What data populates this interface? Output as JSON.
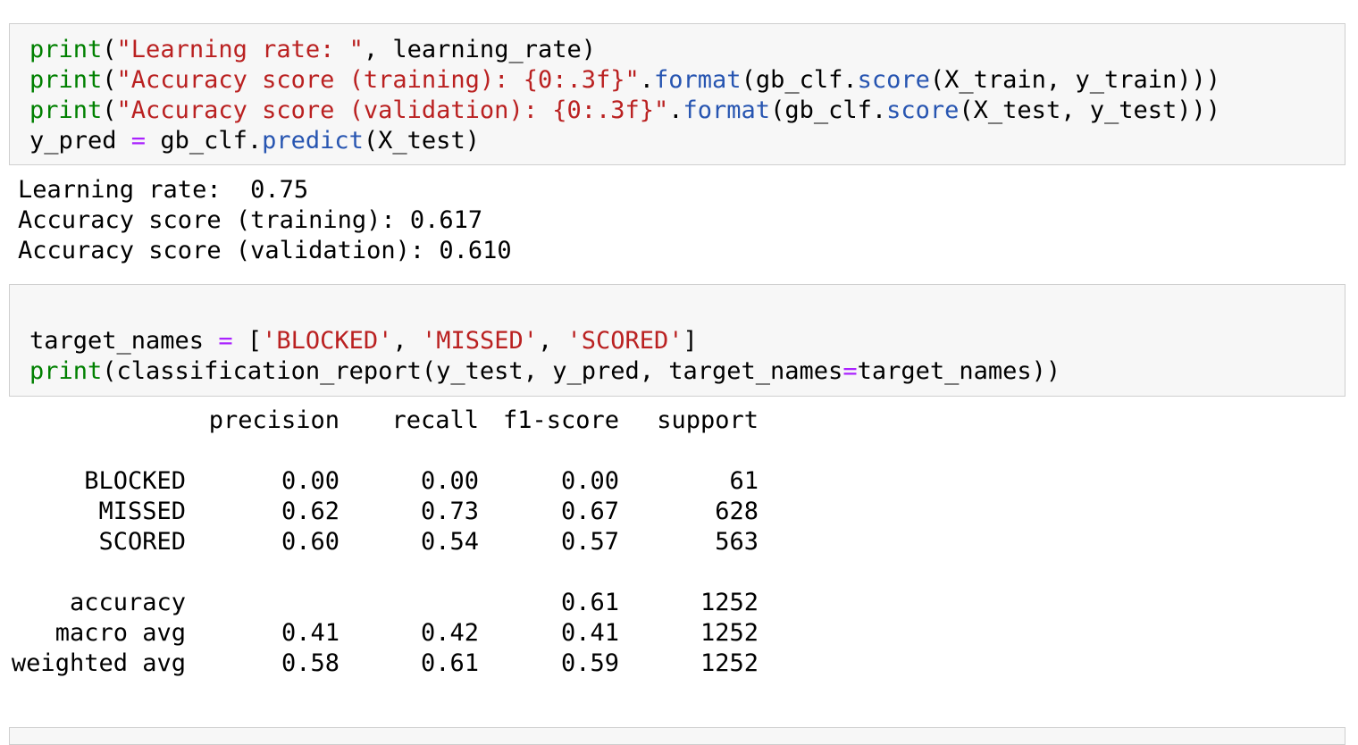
{
  "cells": [
    {
      "lines": [
        [
          {
            "t": "print",
            "c": "kw-green"
          },
          {
            "t": "(",
            "c": "fx"
          },
          {
            "t": "\"Learning rate: \"",
            "c": "str"
          },
          {
            "t": ", learning_rate)",
            "c": "fx"
          }
        ],
        [
          {
            "t": "print",
            "c": "kw-green"
          },
          {
            "t": "(",
            "c": "fx"
          },
          {
            "t": "\"Accuracy score (training): {0:.3f}\"",
            "c": "str"
          },
          {
            "t": ".",
            "c": "fx"
          },
          {
            "t": "format",
            "c": "meth"
          },
          {
            "t": "(gb_clf.",
            "c": "fx"
          },
          {
            "t": "score",
            "c": "meth"
          },
          {
            "t": "(X_train, y_train)))",
            "c": "fx"
          }
        ],
        [
          {
            "t": "print",
            "c": "kw-green"
          },
          {
            "t": "(",
            "c": "fx"
          },
          {
            "t": "\"Accuracy score (validation): {0:.3f}\"",
            "c": "str"
          },
          {
            "t": ".",
            "c": "fx"
          },
          {
            "t": "format",
            "c": "meth"
          },
          {
            "t": "(gb_clf.",
            "c": "fx"
          },
          {
            "t": "score",
            "c": "meth"
          },
          {
            "t": "(X_test, y_test)))",
            "c": "fx"
          }
        ],
        [
          {
            "t": "y_pred ",
            "c": "fx"
          },
          {
            "t": "=",
            "c": "op"
          },
          {
            "t": " gb_clf.",
            "c": "fx"
          },
          {
            "t": "predict",
            "c": "meth"
          },
          {
            "t": "(X_test)",
            "c": "fx"
          }
        ]
      ],
      "output": [
        "Learning rate:  0.75",
        "Accuracy score (training): 0.617",
        "Accuracy score (validation): 0.610"
      ]
    },
    {
      "lines": [
        [],
        [
          {
            "t": "target_names ",
            "c": "fx"
          },
          {
            "t": "=",
            "c": "op"
          },
          {
            "t": " [",
            "c": "fx"
          },
          {
            "t": "'BLOCKED'",
            "c": "str"
          },
          {
            "t": ", ",
            "c": "fx"
          },
          {
            "t": "'MISSED'",
            "c": "str"
          },
          {
            "t": ", ",
            "c": "fx"
          },
          {
            "t": "'SCORED'",
            "c": "str"
          },
          {
            "t": "]",
            "c": "fx"
          }
        ],
        [
          {
            "t": "print",
            "c": "kw-green"
          },
          {
            "t": "(classification_report(y_test, y_pred, target_names",
            "c": "fx"
          },
          {
            "t": "=",
            "c": "op"
          },
          {
            "t": "target_names))",
            "c": "fx"
          }
        ]
      ]
    }
  ],
  "report": {
    "headers": [
      "precision",
      "recall",
      "f1-score",
      "support"
    ],
    "rows": [
      {
        "label": "BLOCKED",
        "values": [
          "0.00",
          "0.00",
          "0.00",
          "61"
        ]
      },
      {
        "label": "MISSED",
        "values": [
          "0.62",
          "0.73",
          "0.67",
          "628"
        ]
      },
      {
        "label": "SCORED",
        "values": [
          "0.60",
          "0.54",
          "0.57",
          "563"
        ]
      },
      null,
      {
        "label": "accuracy",
        "values": [
          "",
          "",
          "0.61",
          "1252"
        ]
      },
      {
        "label": "macro avg",
        "values": [
          "0.41",
          "0.42",
          "0.41",
          "1252"
        ]
      },
      {
        "label": "weighted avg",
        "values": [
          "0.58",
          "0.61",
          "0.59",
          "1252"
        ]
      }
    ]
  },
  "colors": {
    "keyword": "#008000",
    "string": "#ba2121",
    "method": "#2755b1",
    "operator": "#aa22ff",
    "cell_background": "#f7f7f7",
    "cell_border": "#cfcfcf"
  }
}
